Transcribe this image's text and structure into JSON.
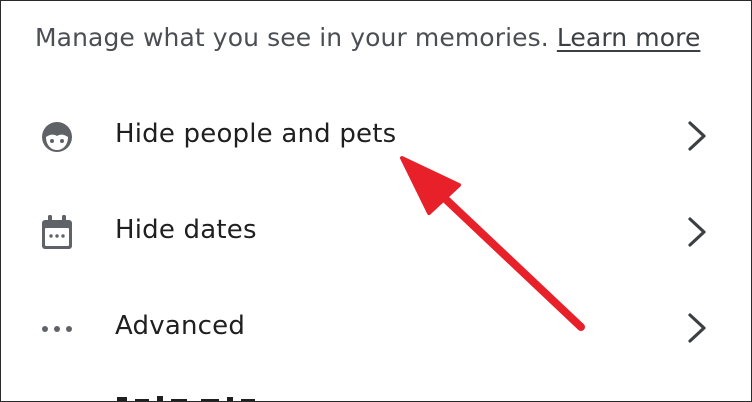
{
  "header": {
    "description": "Manage what you see in your memories.",
    "link_label": "Learn more"
  },
  "menu": {
    "items": [
      {
        "label": "Hide people and pets",
        "icon": "face-icon"
      },
      {
        "label": "Hide dates",
        "icon": "calendar-icon"
      },
      {
        "label": "Advanced",
        "icon": "more-horiz-icon"
      }
    ]
  },
  "colors": {
    "icon": "#5f6368",
    "text": "#1f1f1f",
    "annotation_arrow": "#e8202a"
  }
}
